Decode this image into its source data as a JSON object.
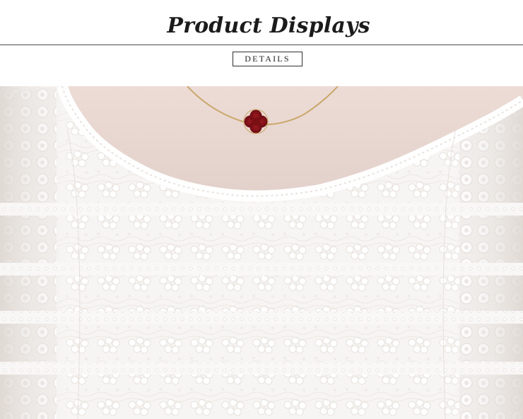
{
  "header": {
    "title": "Product Displays",
    "badge_label": "DETAILS"
  },
  "colors": {
    "title_text": "#1b1b1b",
    "rule_line": "#4a4a4a",
    "skin_tone": "#e8d8d3",
    "lace_white": "#ffffff",
    "pendant_red": "#7a0f14",
    "chain_gold": "#c9a86a"
  },
  "photo": {
    "subject": "white-lace-top-with-clover-pendant"
  }
}
